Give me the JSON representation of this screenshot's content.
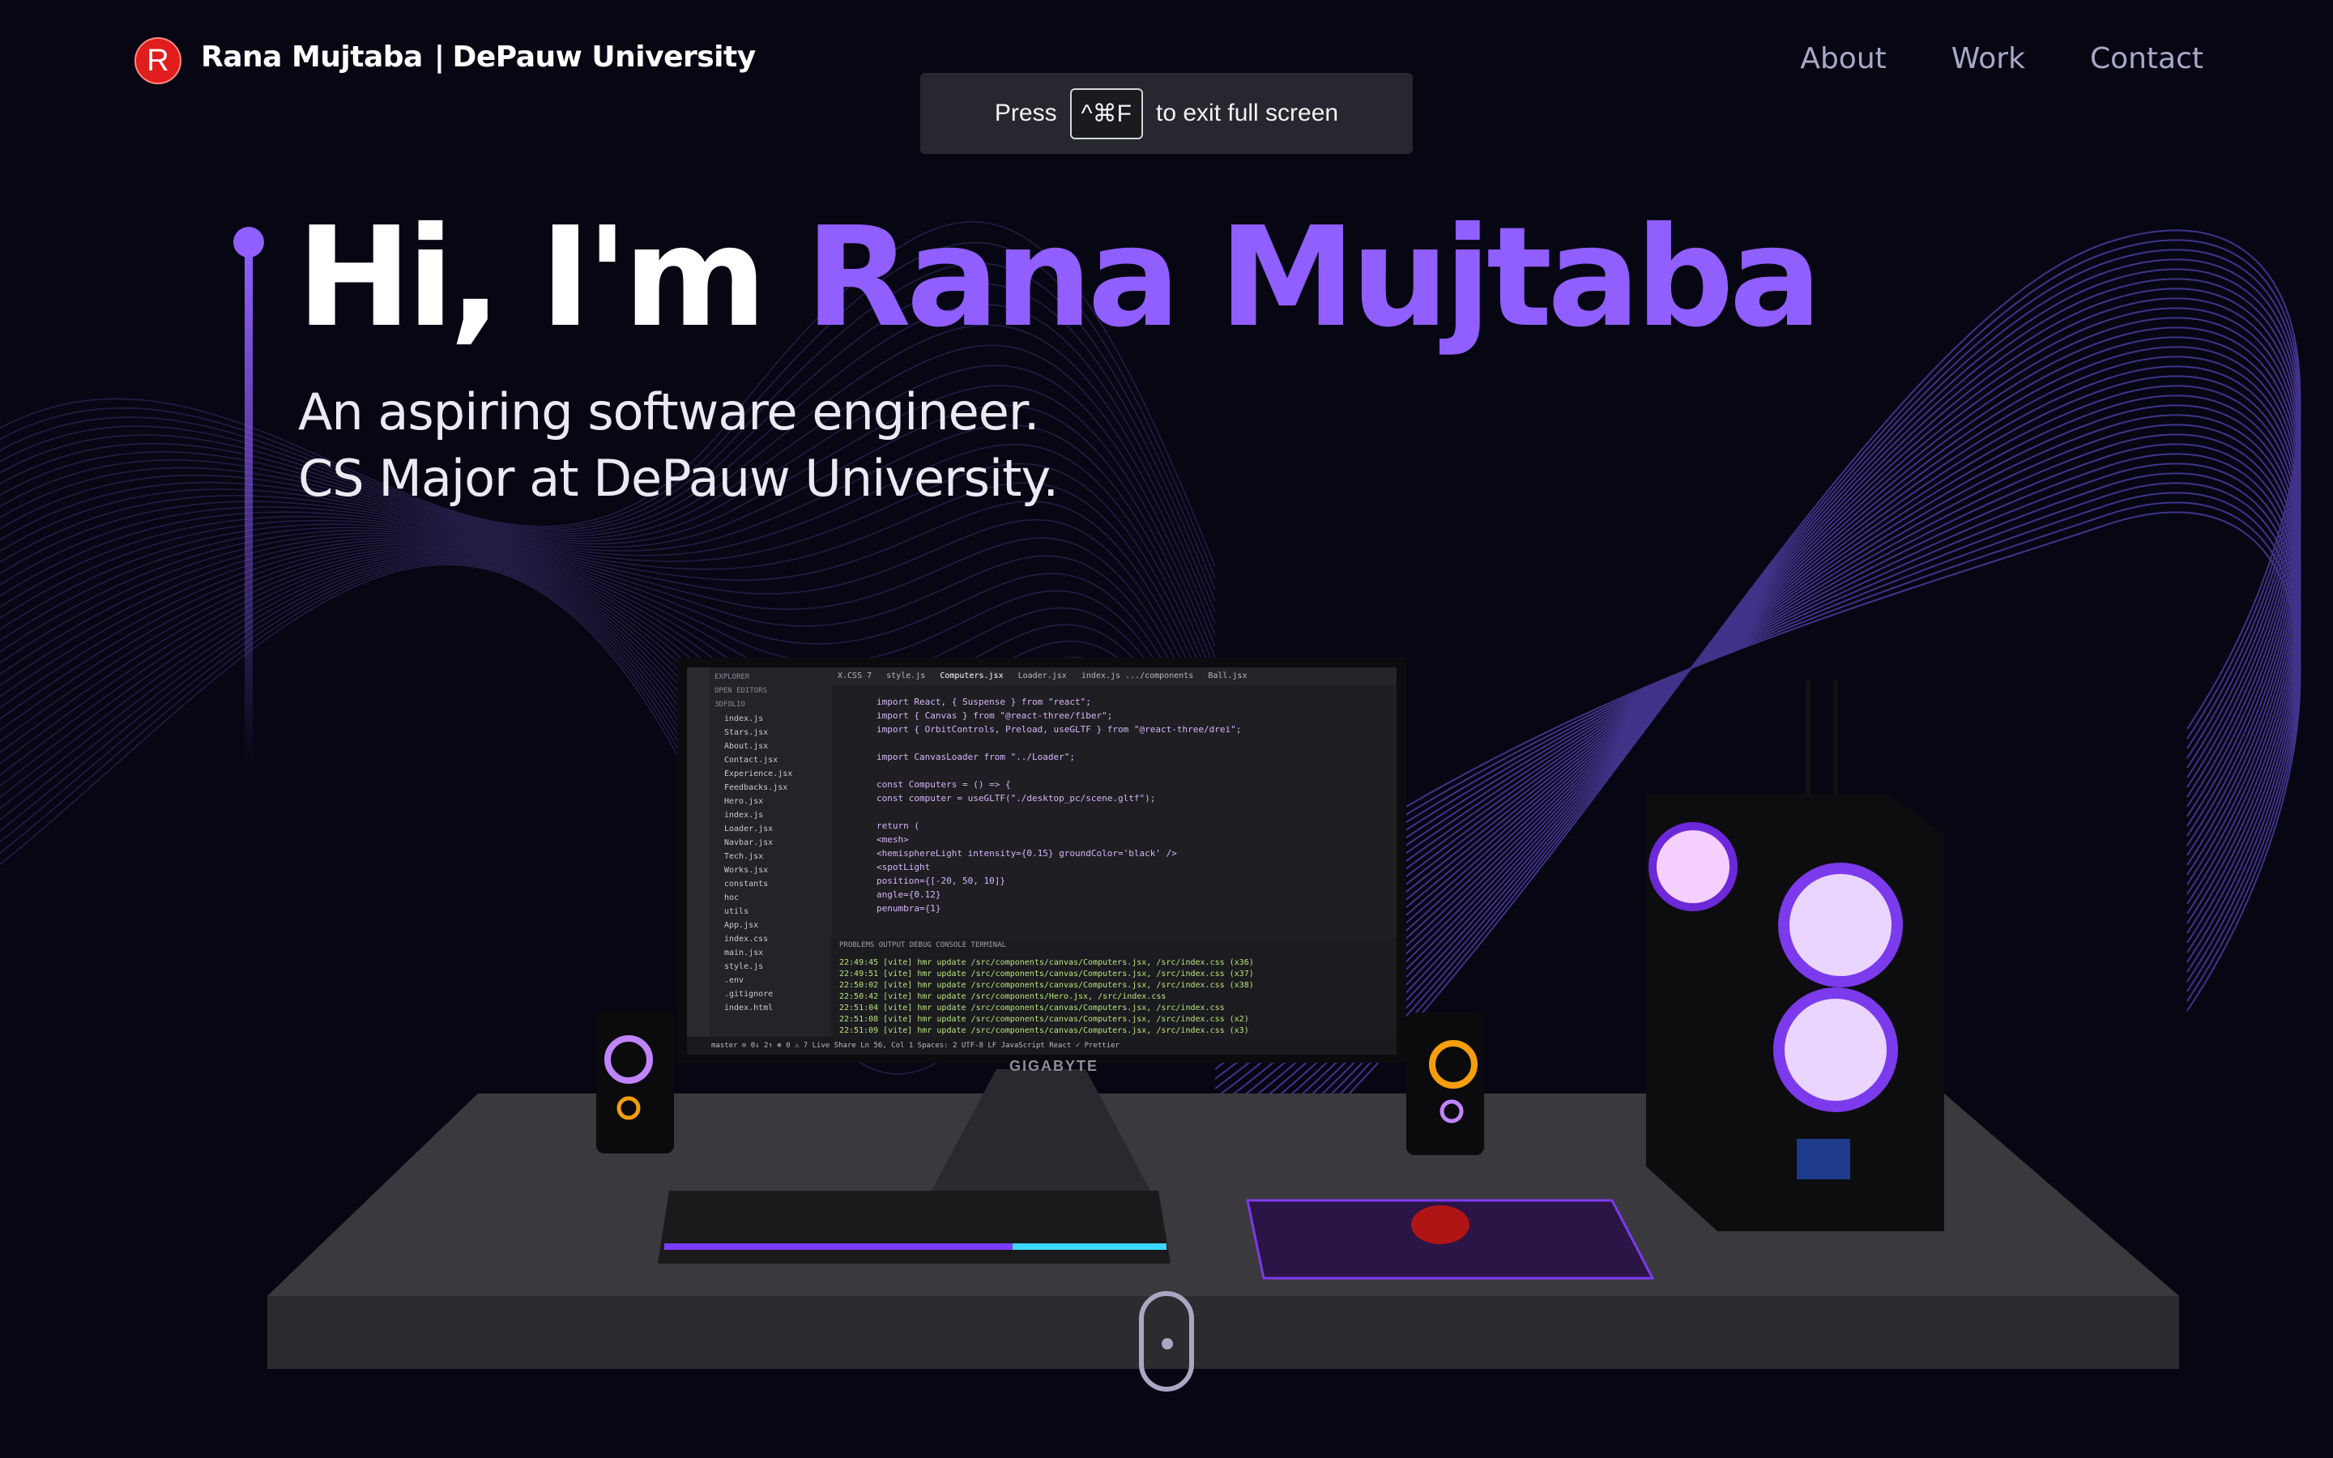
{
  "navbar": {
    "logo_letter": "R",
    "brand_name": "Rana Mujtaba",
    "brand_separator": "|",
    "brand_affiliation": "DePauw University",
    "links": [
      "About",
      "Work",
      "Contact"
    ]
  },
  "fullscreen_toast": {
    "prefix": "Press",
    "shortcut": "^⌘F",
    "suffix": "to exit full screen"
  },
  "hero": {
    "greeting": "Hi, I'm",
    "name": "Rana Mujtaba",
    "subtitle_line1": "An aspiring software engineer.",
    "subtitle_line2": "CS Major at DePauw University."
  },
  "editor": {
    "tabs": [
      "X.CSS 7",
      "style.js",
      "Computers.jsx",
      "Loader.jsx",
      "index.js .../components",
      "Ball.jsx"
    ],
    "sidebar": [
      "EXPLORER",
      "OPEN EDITORS",
      "3DFOLIO",
      "index.js",
      "Stars.jsx",
      "About.jsx",
      "Contact.jsx",
      "Experience.jsx",
      "Feedbacks.jsx",
      "Hero.jsx",
      "index.js",
      "Loader.jsx",
      "Navbar.jsx",
      "Tech.jsx",
      "Works.jsx",
      "constants",
      "hoc",
      "utils",
      "App.jsx",
      "index.css",
      "main.jsx",
      "style.js",
      ".env",
      ".gitignore",
      "index.html"
    ],
    "code_lines": [
      "import React, { Suspense } from \"react\";",
      "import { Canvas } from \"@react-three/fiber\";",
      "import { OrbitControls, Preload, useGLTF } from \"@react-three/drei\";",
      "",
      "import CanvasLoader from \"../Loader\";",
      "",
      "const Computers = () => {",
      "  const computer = useGLTF(\"./desktop_pc/scene.gltf\");",
      "",
      "  return (",
      "    <mesh>",
      "      <hemisphereLight intensity={0.15} groundColor='black' />",
      "      <spotLight",
      "        position={[-20, 50, 10]}",
      "        angle={0.12}",
      "        penumbra={1}"
    ],
    "terminal_tabs": "PROBLEMS  OUTPUT  DEBUG CONSOLE  TERMINAL",
    "terminal_lines": [
      "22:49:45 [vite] hmr update /src/components/canvas/Computers.jsx, /src/index.css (x36)",
      "22:49:51 [vite] hmr update /src/components/canvas/Computers.jsx, /src/index.css (x37)",
      "22:50:02 [vite] hmr update /src/components/canvas/Computers.jsx, /src/index.css (x38)",
      "22:50:42 [vite] hmr update /src/components/Hero.jsx, /src/index.css",
      "22:51:04 [vite] hmr update /src/components/canvas/Computers.jsx, /src/index.css",
      "22:51:08 [vite] hmr update /src/components/canvas/Computers.jsx, /src/index.css (x2)",
      "22:51:09 [vite] hmr update /src/components/canvas/Computers.jsx, /src/index.css (x3)"
    ],
    "status_bar": "master  ⊙ 0↓ 2↑  ⊗ 0 ⚠ 7  Live Share      Ln 56, Col 1  Spaces: 2  UTF-8  LF  JavaScript React  ✓ Prettier",
    "monitor_brand": "GIGABYTE"
  },
  "colors": {
    "background": "#070714",
    "accent": "#915eff",
    "nav_link": "#a9a8c8",
    "logo_red": "#e11d1d"
  },
  "icons": [
    "logo-circle-icon",
    "mouse-scroll-icon"
  ]
}
